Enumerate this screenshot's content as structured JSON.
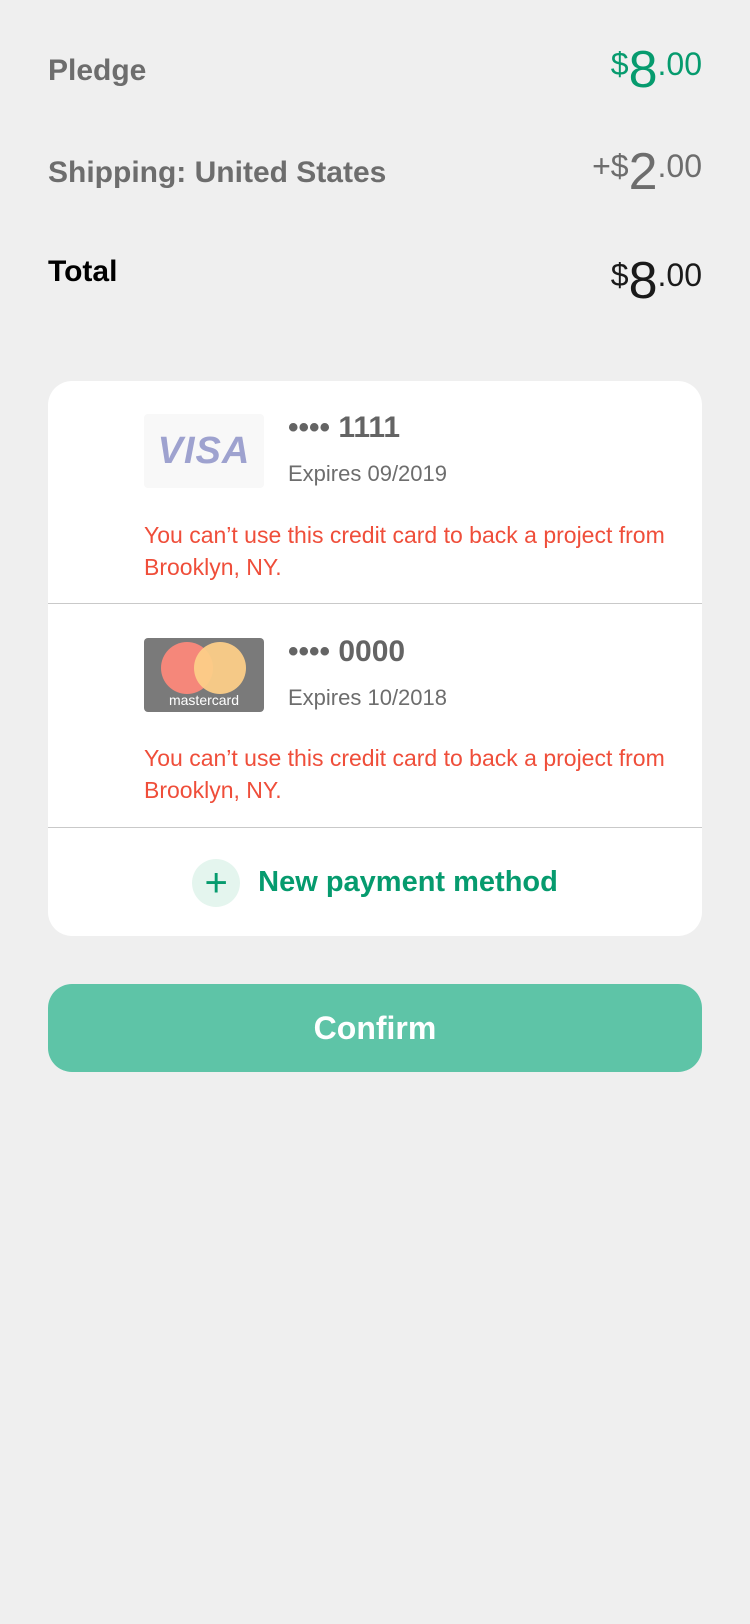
{
  "summary": {
    "pledge": {
      "label": "Pledge",
      "prefix": "$",
      "whole": "8",
      "cents": ".00",
      "color": "#069b6e"
    },
    "shipping": {
      "label": "Shipping: United States",
      "prefix": "+$",
      "whole": "2",
      "cents": ".00"
    },
    "total": {
      "label": "Total",
      "prefix": "$",
      "whole": "8",
      "cents": ".00"
    }
  },
  "payment_methods": [
    {
      "brand_icon": "visa-logo",
      "brand_text": "VISA",
      "number": "•••• 1111",
      "expiry": "Expires 09/2019",
      "error": "You can’t use this credit card to back a project from Brooklyn, NY."
    },
    {
      "brand_icon": "mastercard-logo",
      "brand_text": "mastercard",
      "number": "•••• 0000",
      "expiry": "Expires 10/2018",
      "error": "You can’t use this credit card to back a project from Brooklyn, NY."
    }
  ],
  "new_payment": {
    "icon": "plus-icon",
    "label": "New payment method"
  },
  "confirm": {
    "label": "Confirm",
    "color": "#5ec4a7"
  },
  "colors": {
    "accent": "#069b6e",
    "error": "#ef4e3a",
    "background": "#efefef"
  }
}
